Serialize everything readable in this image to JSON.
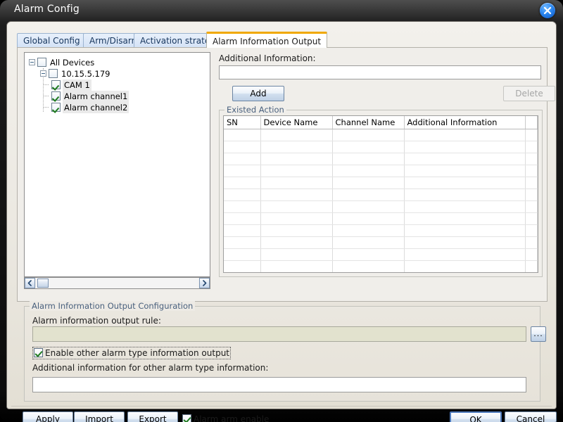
{
  "window": {
    "title": "Alarm Config",
    "close_icon": "close-circle-icon"
  },
  "tabs": [
    {
      "label": "Global Config",
      "active": false
    },
    {
      "label": "Arm/Disarm",
      "active": false
    },
    {
      "label": "Activation strategy",
      "active": false
    },
    {
      "label": "Alarm Information Output",
      "active": true
    }
  ],
  "tree": {
    "nodes": [
      {
        "label": "All Devices",
        "depth": 0,
        "expander": "minus",
        "checked": false,
        "highlight": false
      },
      {
        "label": "10.15.5.179",
        "depth": 1,
        "expander": "minus",
        "checked": false,
        "highlight": false
      },
      {
        "label": "CAM 1",
        "depth": 2,
        "expander": "none",
        "checked": true,
        "highlight": true
      },
      {
        "label": "Alarm channel1",
        "depth": 2,
        "expander": "none",
        "checked": true,
        "highlight": true
      },
      {
        "label": "Alarm channel2",
        "depth": 2,
        "expander": "none",
        "checked": true,
        "highlight": true
      }
    ],
    "scrollbar": {
      "left_arrow_icon": "chevron-left-icon",
      "right_arrow_icon": "chevron-right-icon"
    }
  },
  "right_panel": {
    "additional_information_label": "Additional Information:",
    "additional_information_value": "",
    "additional_information_placeholder": "",
    "add_label": "Add",
    "delete_label": "Delete",
    "delete_disabled": true,
    "existed_action_legend": "Existed Action",
    "table": {
      "columns": [
        "SN",
        "Device Name",
        "Channel Name",
        "Additional Information"
      ],
      "rows": []
    }
  },
  "output_config": {
    "legend": "Alarm Information Output Configuration",
    "rule_label": "Alarm information output rule:",
    "rule_value": "",
    "browse_label": "...",
    "enable_other_label": "Enable other alarm type information output",
    "enable_other_checked": true,
    "other_info_label": "Additional information for other alarm type information:",
    "other_info_value": ""
  },
  "footer": {
    "apply_label": "Apply",
    "import_label": "Import",
    "export_label": "Export",
    "alarm_arm_label": "Alarm arm enable",
    "alarm_arm_checked": true,
    "ok_label": "OK",
    "cancel_label": "Cancel"
  },
  "colors": {
    "active_tab_accent": "#f0a800",
    "title_bar": "#151515",
    "dialog_background": "#ece9e4",
    "readonly_field": "#e2e2ce",
    "checkmark_green": "#1d7a1d",
    "group_legend_text": "#49607d",
    "default_button_border": "#4f7bbd"
  }
}
